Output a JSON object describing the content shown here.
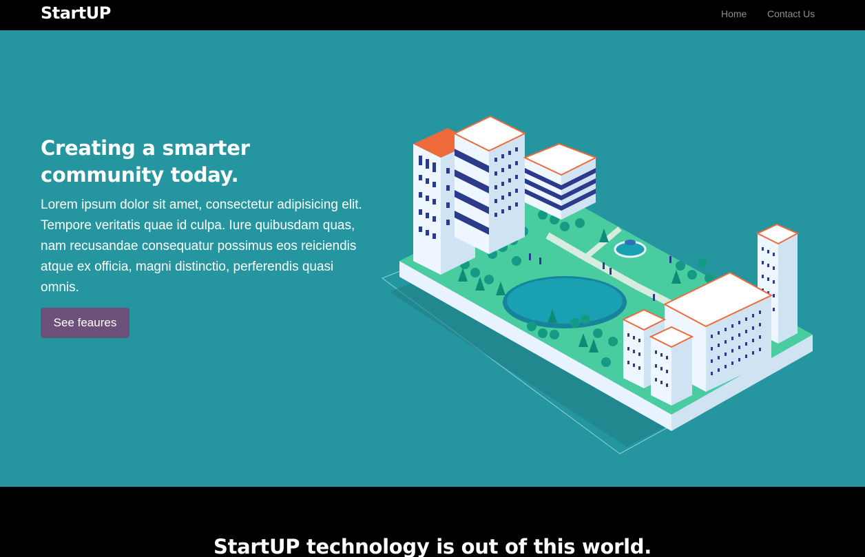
{
  "navbar": {
    "brand": "StartUP",
    "links": [
      {
        "label": "Home"
      },
      {
        "label": "Contact Us"
      }
    ]
  },
  "hero": {
    "title": "Creating a smarter community today.",
    "text": "Lorem ipsum dolor sit amet, consectetur adipisicing elit. Tempore veritatis quae id culpa. Iure quibusdam quas, nam recusandae consequatur possimus eos reiciendis atque ex officia, magni distinctio, perferendis quasi omnis.",
    "button_label": "See feaures",
    "illustration_icon": "isometric-city-illustration"
  },
  "section": {
    "heading": "StartUP technology is out of this world."
  },
  "colors": {
    "hero_background": "#2596a0",
    "navbar_background": "#000000",
    "button_background": "#6d5079",
    "park_green": "#49cc9f",
    "building_accent": "#2b3a8a",
    "roof_accent": "#ef6a3a"
  }
}
